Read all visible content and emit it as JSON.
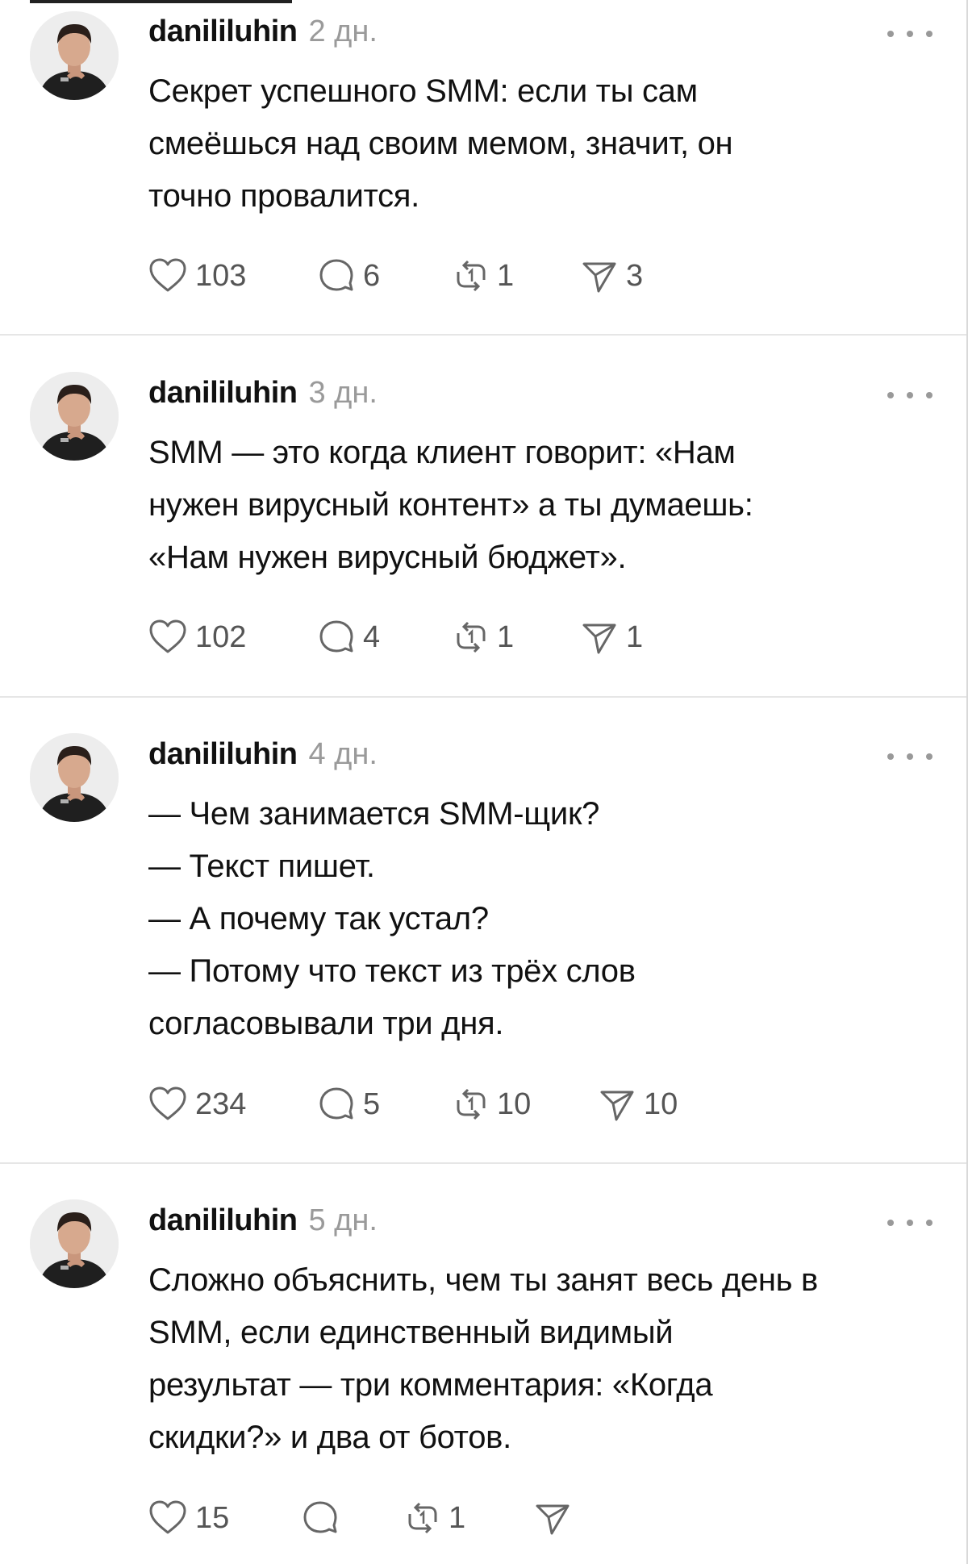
{
  "posts": [
    {
      "username": "danililuhin",
      "time": "2 дн.",
      "text_lines": [
        "Секрет успешного SMM: если ты сам",
        "смеёшься над своим мемом, значит, он",
        "точно провалится."
      ],
      "likes": "103",
      "replies": "6",
      "reposts": "1",
      "shares": "3"
    },
    {
      "username": "danililuhin",
      "time": "3 дн.",
      "text_lines": [
        "SMM — это когда клиент говорит: «Нам",
        "нужен вирусный контент» а ты думаешь:",
        "«Нам нужен вирусный бюджет»."
      ],
      "likes": "102",
      "replies": "4",
      "reposts": "1",
      "shares": "1"
    },
    {
      "username": "danililuhin",
      "time": "4 дн.",
      "text_lines": [
        "— Чем занимается SMM-щик?",
        "— Текст пишет.",
        "— А почему так устал?",
        "— Потому что текст из трёх слов",
        "согласовывали три дня."
      ],
      "likes": "234",
      "replies": "5",
      "reposts": "10",
      "shares": "10"
    },
    {
      "username": "danililuhin",
      "time": "5 дн.",
      "text_lines": [
        "Сложно объяснить, чем ты занят весь день в",
        "SMM, если единственный видимый",
        "результат — три комментария: «Когда",
        "скидки?» и два от ботов."
      ],
      "likes": "15",
      "replies": "",
      "reposts": "1",
      "shares": ""
    }
  ],
  "icons": {
    "like": "heart-icon",
    "reply": "comment-icon",
    "repost": "repost-icon",
    "share": "send-icon",
    "more": "more-dots-icon"
  },
  "colors": {
    "text": "#111111",
    "muted": "#9a9a9a",
    "count": "#555555",
    "divider": "#e6e6e6"
  }
}
